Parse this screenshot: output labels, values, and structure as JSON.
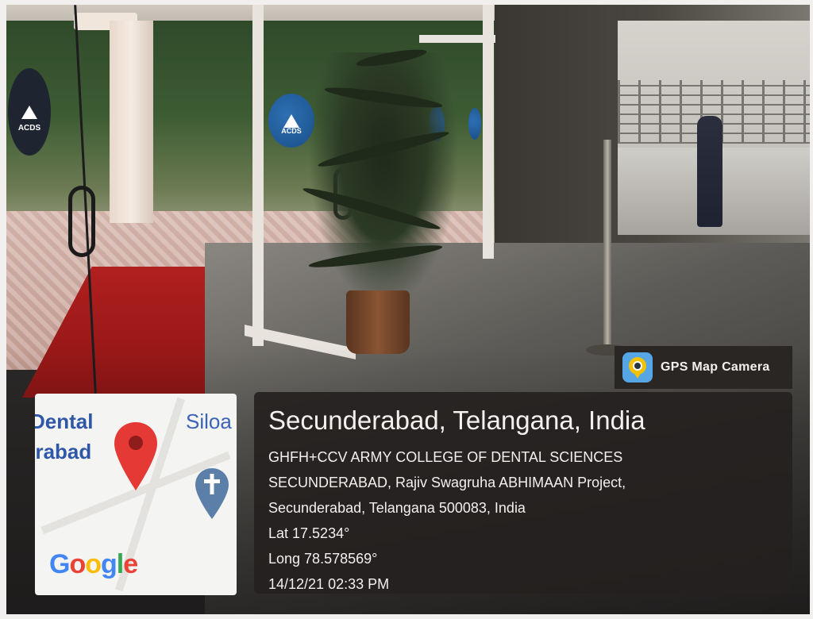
{
  "photo": {
    "description_icons": [
      "map-pin-icon",
      "church-icon",
      "gps-camera-icon"
    ]
  },
  "gps_badge": {
    "label": "GPS Map Camera",
    "icon": "gps-camera-icon"
  },
  "location": {
    "title": "Secunderabad, Telangana, India",
    "address_line_1": "GHFH+CCV ARMY COLLEGE OF DENTAL SCIENCES",
    "address_line_2": "SECUNDERABAD, Rajiv Swagruha ABHIMAAN Project,",
    "address_line_3": "Secunderabad, Telangana 500083, India",
    "lat": "Lat 17.5234°",
    "long": "Long 78.578569°",
    "datetime": "14/12/21 02:33 PM"
  },
  "map": {
    "label_1": "Dental",
    "label_2": "erabad",
    "label_3": "Siloa",
    "google_logo": [
      "G",
      "o",
      "o",
      "g",
      "l",
      "e"
    ],
    "google_colors": [
      "#4285F4",
      "#EA4335",
      "#FBBC05",
      "#4285F4",
      "#34A853",
      "#EA4335"
    ],
    "pin_color": "#e53935",
    "church_pin_color": "#5b7fa8"
  },
  "glass_signs": [
    "ACDS",
    "ACDS"
  ]
}
